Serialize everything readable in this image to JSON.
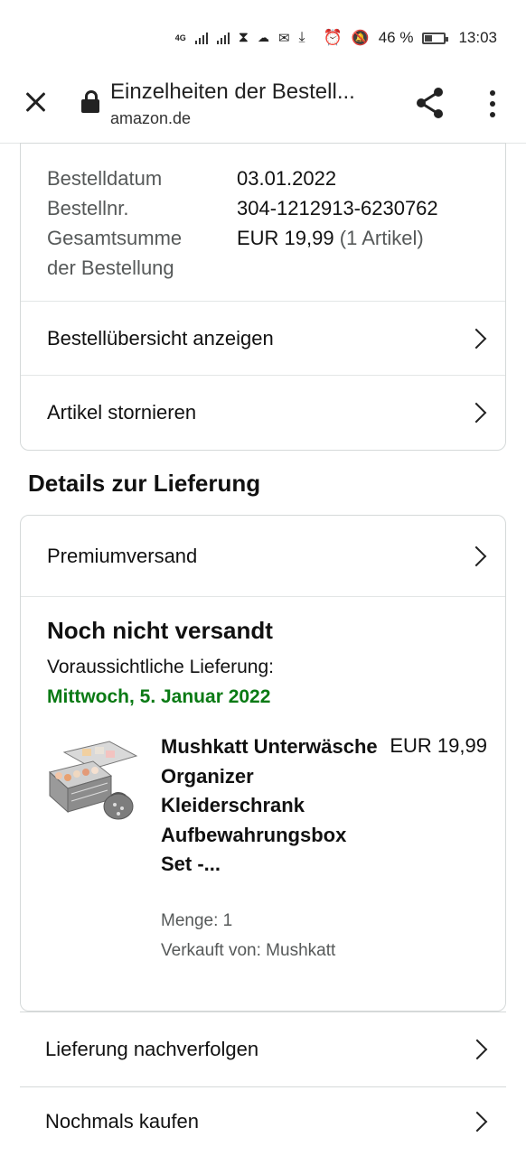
{
  "status_bar": {
    "network": "4G",
    "battery_percent": "46 %",
    "battery_level": 0.46,
    "time": "13:03",
    "icons": [
      "signal-4g-icon",
      "signal-icon",
      "hourglass-icon",
      "cloud-icon",
      "mail-icon",
      "download-icon",
      "alarm-icon",
      "mute-icon",
      "battery-icon"
    ]
  },
  "browser": {
    "title": "Einzelheiten der Bestell...",
    "url": "amazon.de",
    "icons": [
      "close-icon",
      "lock-icon",
      "share-icon",
      "more-vert-icon"
    ]
  },
  "order_info": {
    "rows": [
      {
        "label": "Bestelldatum",
        "value": "03.01.2022"
      },
      {
        "label": "Bestellnr.",
        "value": "304-1212913-6230762"
      },
      {
        "label": "Gesamtsumme der Bestellung",
        "value": "EUR 19,99",
        "value_note": "(1 Artikel)"
      }
    ],
    "label_line1": "Gesamtsumme",
    "label_line2": "der Bestellung",
    "links": [
      {
        "label": "Bestellübersicht anzeigen"
      },
      {
        "label": "Artikel stornieren"
      }
    ]
  },
  "delivery": {
    "heading": "Details zur Lieferung",
    "shipping_method": "Premiumversand",
    "status": "Noch nicht versandt",
    "estimated_label": "Voraussichtliche Lieferung:",
    "estimated_date": "Mittwoch, 5. Januar 2022",
    "item": {
      "title": "Mushkatt Unterwäsche Organizer Kleiderschrank Aufbewahrungsbox Set -...",
      "price": "EUR 19,99",
      "quantity": "Menge: 1",
      "seller": "Verkauft von: Mushkatt"
    }
  },
  "actions": [
    {
      "label": "Lieferung nachverfolgen"
    },
    {
      "label": "Nochmals kaufen"
    }
  ],
  "colors": {
    "delivery_date": "#0a7a14",
    "muted_text": "#565959",
    "border": "#d5d9d9"
  }
}
